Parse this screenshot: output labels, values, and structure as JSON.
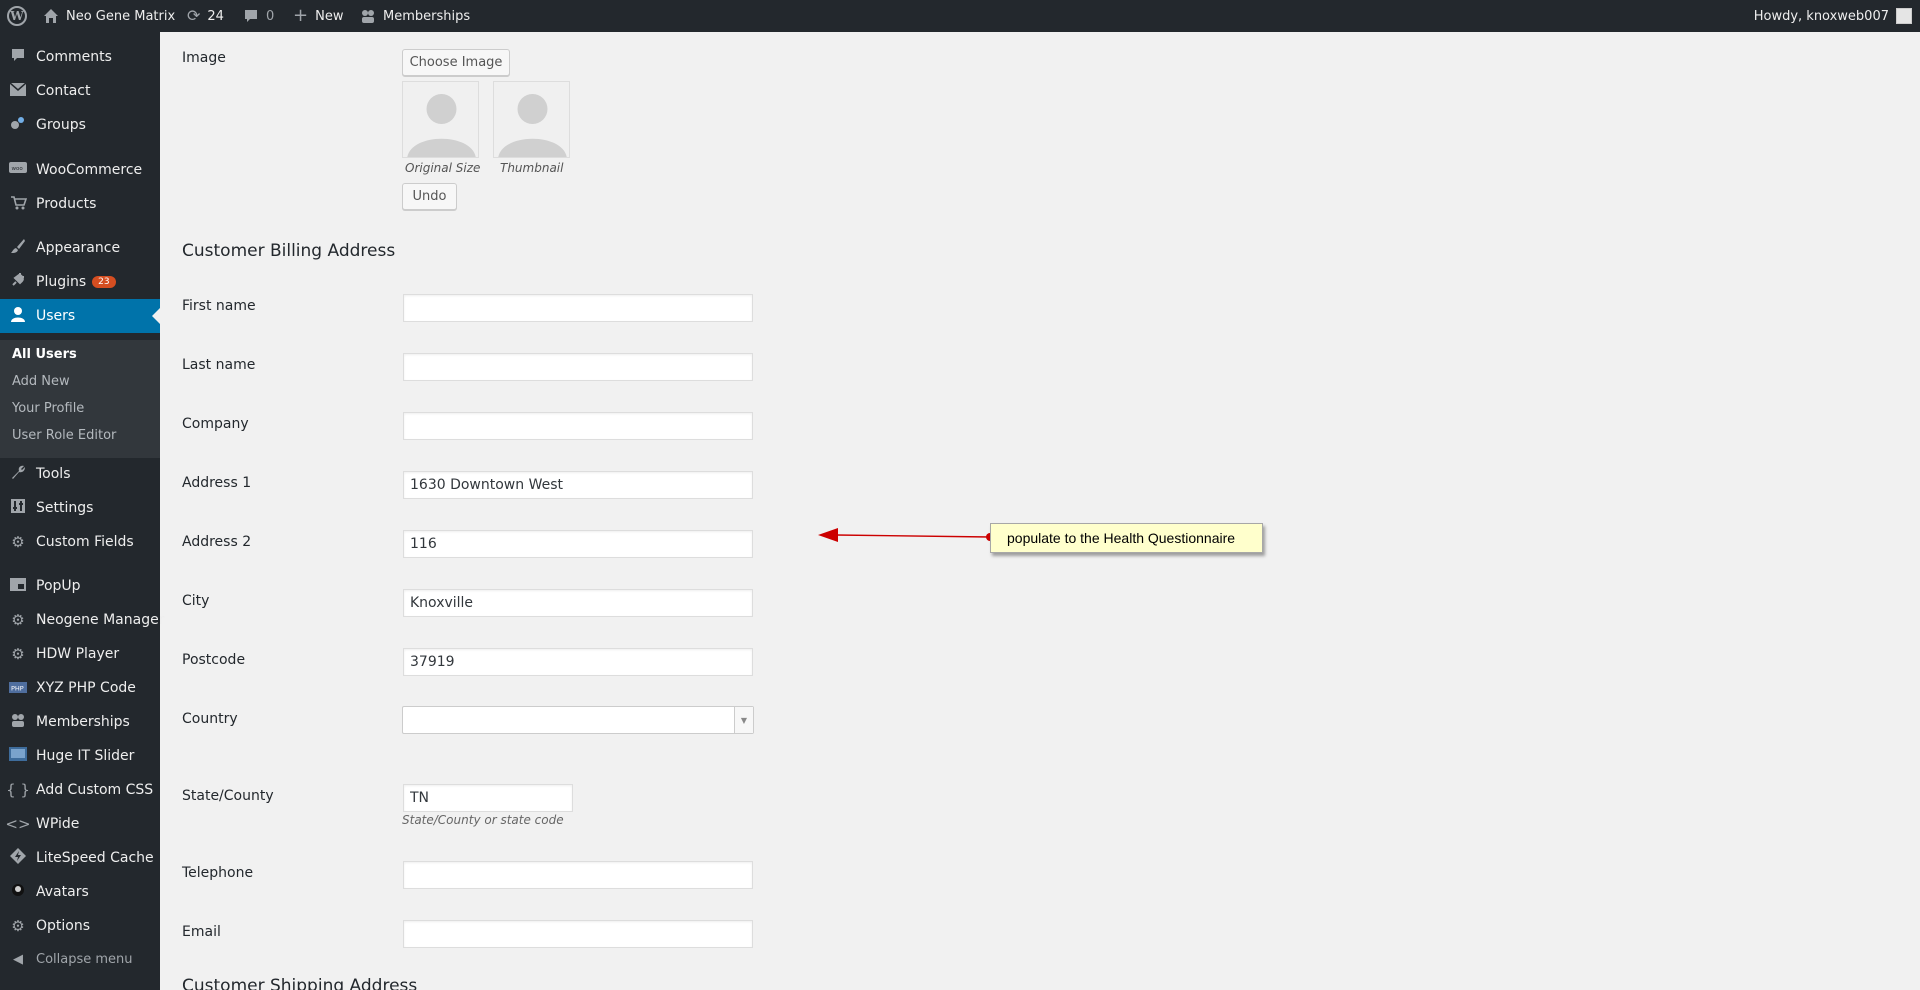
{
  "admin_bar": {
    "site_name": "Neo Gene Matrix",
    "updates_count": "24",
    "comments_count": "0",
    "new_label": "New",
    "memberships_label": "Memberships",
    "howdy": "Howdy, knoxweb007"
  },
  "sidebar": {
    "items": [
      {
        "label": "Comments",
        "icon": "comment-icon"
      },
      {
        "label": "Contact",
        "icon": "mail-icon"
      },
      {
        "label": "Groups",
        "icon": "groups-icon"
      },
      {
        "label": "WooCommerce",
        "icon": "woocommerce-icon"
      },
      {
        "label": "Products",
        "icon": "cart-icon"
      },
      {
        "label": "Appearance",
        "icon": "paintbrush-icon"
      },
      {
        "label": "Plugins",
        "icon": "plugin-icon",
        "badge": "23"
      },
      {
        "label": "Users",
        "icon": "user-icon"
      },
      {
        "label": "Tools",
        "icon": "wrench-icon"
      },
      {
        "label": "Settings",
        "icon": "settings-icon"
      },
      {
        "label": "Custom Fields",
        "icon": "gear-icon"
      },
      {
        "label": "PopUp",
        "icon": "popup-icon"
      },
      {
        "label": "Neogene Manager",
        "icon": "gear-icon"
      },
      {
        "label": "HDW Player",
        "icon": "gear-icon"
      },
      {
        "label": "XYZ PHP Code",
        "icon": "php-icon"
      },
      {
        "label": "Memberships",
        "icon": "groups-icon"
      },
      {
        "label": "Huge IT Slider",
        "icon": "slider-icon"
      },
      {
        "label": "Add Custom CSS",
        "icon": "braces-icon"
      },
      {
        "label": "WPide",
        "icon": "code-icon"
      },
      {
        "label": "LiteSpeed Cache",
        "icon": "litespeed-icon"
      },
      {
        "label": "Avatars",
        "icon": "avatar-icon"
      },
      {
        "label": "Options",
        "icon": "gear-icon"
      }
    ],
    "submenu": [
      "All Users",
      "Add New",
      "Your Profile",
      "User Role Editor"
    ],
    "collapse_label": "Collapse menu"
  },
  "image_section": {
    "label": "Image",
    "choose_button": "Choose Image",
    "original_caption": "Original Size",
    "thumbnail_caption": "Thumbnail",
    "undo_button": "Undo"
  },
  "billing": {
    "title": "Customer Billing Address",
    "fields": {
      "first_name": {
        "label": "First name",
        "value": ""
      },
      "last_name": {
        "label": "Last name",
        "value": ""
      },
      "company": {
        "label": "Company",
        "value": ""
      },
      "address1": {
        "label": "Address 1",
        "value": "1630 Downtown West"
      },
      "address2": {
        "label": "Address 2",
        "value": "116"
      },
      "city": {
        "label": "City",
        "value": "Knoxville"
      },
      "postcode": {
        "label": "Postcode",
        "value": "37919"
      },
      "country": {
        "label": "Country",
        "value": ""
      },
      "state": {
        "label": "State/County",
        "value": "TN",
        "description": "State/County or state code"
      },
      "telephone": {
        "label": "Telephone",
        "value": ""
      },
      "email": {
        "label": "Email",
        "value": ""
      }
    }
  },
  "shipping": {
    "title": "Customer Shipping Address"
  },
  "annotation": {
    "text": "populate to the Health Questionnaire",
    "color": "#cc0000"
  }
}
